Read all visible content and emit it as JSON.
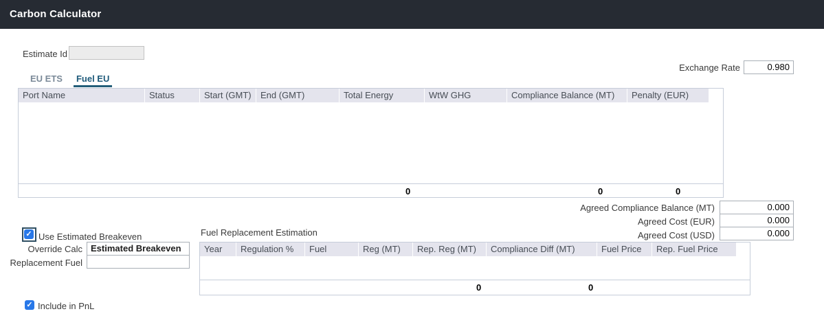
{
  "header": {
    "title": "Carbon Calculator"
  },
  "form": {
    "estimate_id": {
      "label": "Estimate Id",
      "value": "",
      "placeholder": ""
    },
    "exchange_rate": {
      "label": "Exchange Rate",
      "value": "0.980"
    }
  },
  "tabs": [
    {
      "label": "EU ETS",
      "active": false
    },
    {
      "label": "Fuel EU",
      "active": true
    }
  ],
  "voyage_table": {
    "columns": [
      "Port Name",
      "Status",
      "Start (GMT)",
      "End (GMT)",
      "Total Energy",
      "WtW GHG",
      "Compliance Balance (MT)",
      "Penalty (EUR)"
    ],
    "rows": [],
    "totals": {
      "total_energy": "0",
      "compliance_balance": "0",
      "penalty": "0"
    }
  },
  "agreed": {
    "rows": [
      {
        "label": "Agreed Compliance Balance (MT)",
        "value": "0.000"
      },
      {
        "label": "Agreed Cost (EUR)",
        "value": "0.000"
      },
      {
        "label": "Agreed Cost (USD)",
        "value": "0.000"
      }
    ]
  },
  "breakeven": {
    "use_estimated_breakeven": {
      "label": "Use Estimated Breakeven",
      "checked": true
    },
    "override_calc": {
      "label": "Override Calc",
      "value": "Estimated Breakeven"
    },
    "replacement_fuel": {
      "label": "Replacement Fuel",
      "value": ""
    }
  },
  "fuel_replacement": {
    "title": "Fuel Replacement Estimation",
    "columns": [
      "Year",
      "Regulation %",
      "Fuel",
      "Reg (MT)",
      "Rep. Reg (MT)",
      "Compliance Diff (MT)",
      "Fuel Price",
      "Rep. Fuel Price"
    ],
    "rows": [],
    "totals": {
      "rep_reg": "0",
      "compliance_diff": "0"
    }
  },
  "include_in_pnl": {
    "label": "Include in PnL",
    "checked": true
  },
  "checkmark_glyph": "✓",
  "colors": {
    "title_bar": "#262b33",
    "tab_active": "#1e5a7a",
    "tab_underline": "#235e79",
    "grid_header_bg": "#e4e4ed",
    "grid_border": "#c6cdd9",
    "checkbox_blue": "#2878e8"
  }
}
